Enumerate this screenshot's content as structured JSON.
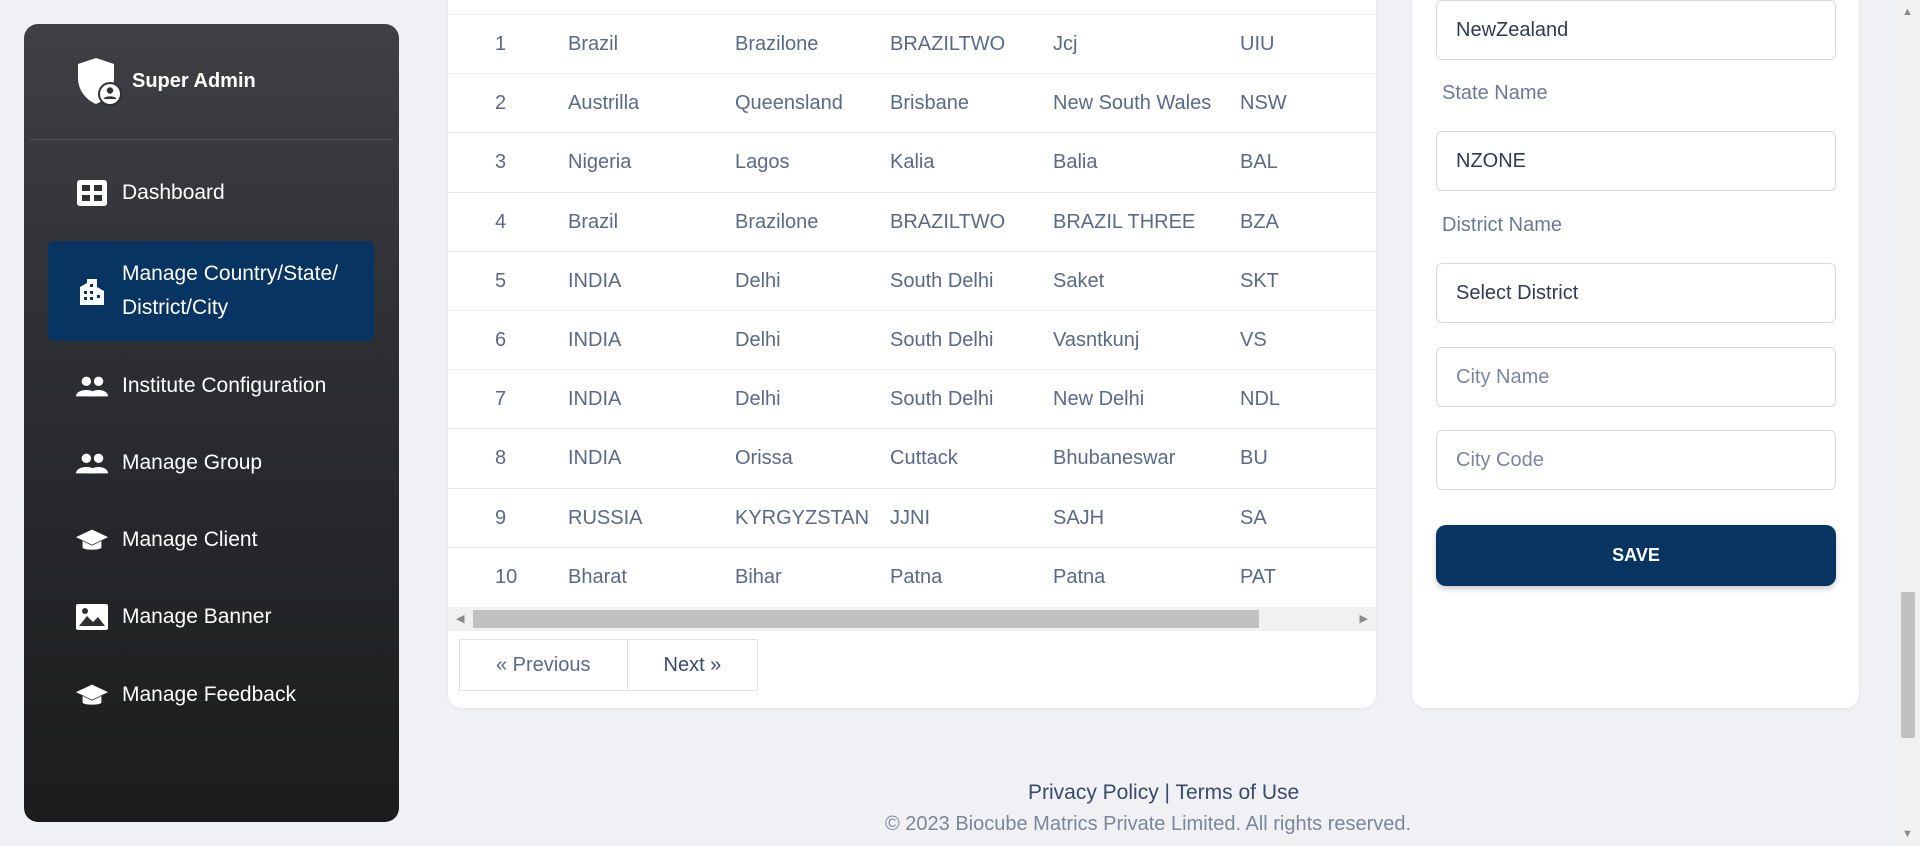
{
  "sidebar": {
    "brand": "Super Admin",
    "items": [
      {
        "label": "Dashboard",
        "icon": "dashboard-icon"
      },
      {
        "label": "Manage Country/State/ District/City",
        "icon": "building-icon",
        "active": true
      },
      {
        "label": "Institute Configuration",
        "icon": "users-icon"
      },
      {
        "label": "Manage Group",
        "icon": "users-icon"
      },
      {
        "label": "Manage Client",
        "icon": "graduation-cap-icon"
      },
      {
        "label": "Manage Banner",
        "icon": "image-icon"
      },
      {
        "label": "Manage Feedback",
        "icon": "graduation-cap-icon"
      }
    ]
  },
  "table": {
    "rows": [
      [
        "1",
        "Brazil",
        "Brazilone",
        "BRAZILTWO",
        "Jcj",
        "UIU"
      ],
      [
        "2",
        "Austrilla",
        "Queensland",
        "Brisbane",
        "New South Wales",
        "NSW"
      ],
      [
        "3",
        "Nigeria",
        "Lagos",
        "Kalia",
        "Balia",
        "BAL"
      ],
      [
        "4",
        "Brazil",
        "Brazilone",
        "BRAZILTWO",
        "BRAZIL THREE",
        "BZA"
      ],
      [
        "5",
        "INDIA",
        "Delhi",
        "South Delhi",
        "Saket",
        "SKT"
      ],
      [
        "6",
        "INDIA",
        "Delhi",
        "South Delhi",
        "Vasntkunj",
        "VS"
      ],
      [
        "7",
        "INDIA",
        "Delhi",
        "South Delhi",
        "New Delhi",
        "NDL"
      ],
      [
        "8",
        "INDIA",
        "Orissa",
        "Cuttack",
        "Bhubaneswar",
        "BU"
      ],
      [
        "9",
        "RUSSIA",
        "KYRGYZSTAN",
        "JJNI",
        "SAJH",
        "SA"
      ],
      [
        "10",
        "Bharat",
        "Bihar",
        "Patna",
        "Patna",
        "PAT"
      ]
    ],
    "prev_label": "« Previous",
    "next_label": "Next »"
  },
  "form": {
    "country_value": "NewZealand",
    "state_label": "State Name",
    "state_value": "NZONE",
    "district_label": "District Name",
    "district_value": "Select District",
    "city_name_placeholder": "City Name",
    "city_code_placeholder": "City Code",
    "save_label": "SAVE"
  },
  "footer": {
    "privacy": "Privacy Policy",
    "separator": "|",
    "terms": "Terms of Use",
    "copyright": "© 2023 Biocube Matrics Private Limited. All rights reserved."
  },
  "colors": {
    "accent": "#073461",
    "sidebar_top": "#3f4045",
    "sidebar_bottom": "#1c1c1e",
    "background": "#f0f1f5"
  }
}
